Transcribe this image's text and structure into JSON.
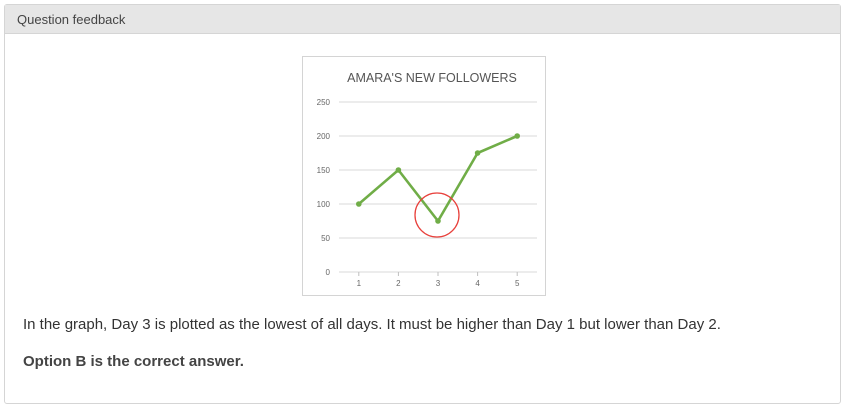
{
  "panel": {
    "header_title": "Question feedback",
    "feedback_text": "In the graph, Day 3 is plotted as the lowest of all days. It must be higher than Day 1 but lower than Day 2.",
    "answer_text": "Option B is the correct answer."
  },
  "colors": {
    "line": "#70ad47",
    "highlight_circle": "#e8413c",
    "grid": "#d9d9d9"
  },
  "chart_data": {
    "type": "line",
    "title": "AMARA'S NEW FOLLOWERS",
    "categories": [
      "1",
      "2",
      "3",
      "4",
      "5"
    ],
    "values": [
      100,
      150,
      75,
      175,
      200
    ],
    "yticks": [
      "0",
      "50",
      "100",
      "150",
      "200",
      "250"
    ],
    "ylim": [
      0,
      250
    ],
    "grid": true,
    "highlighted_category": "3"
  }
}
